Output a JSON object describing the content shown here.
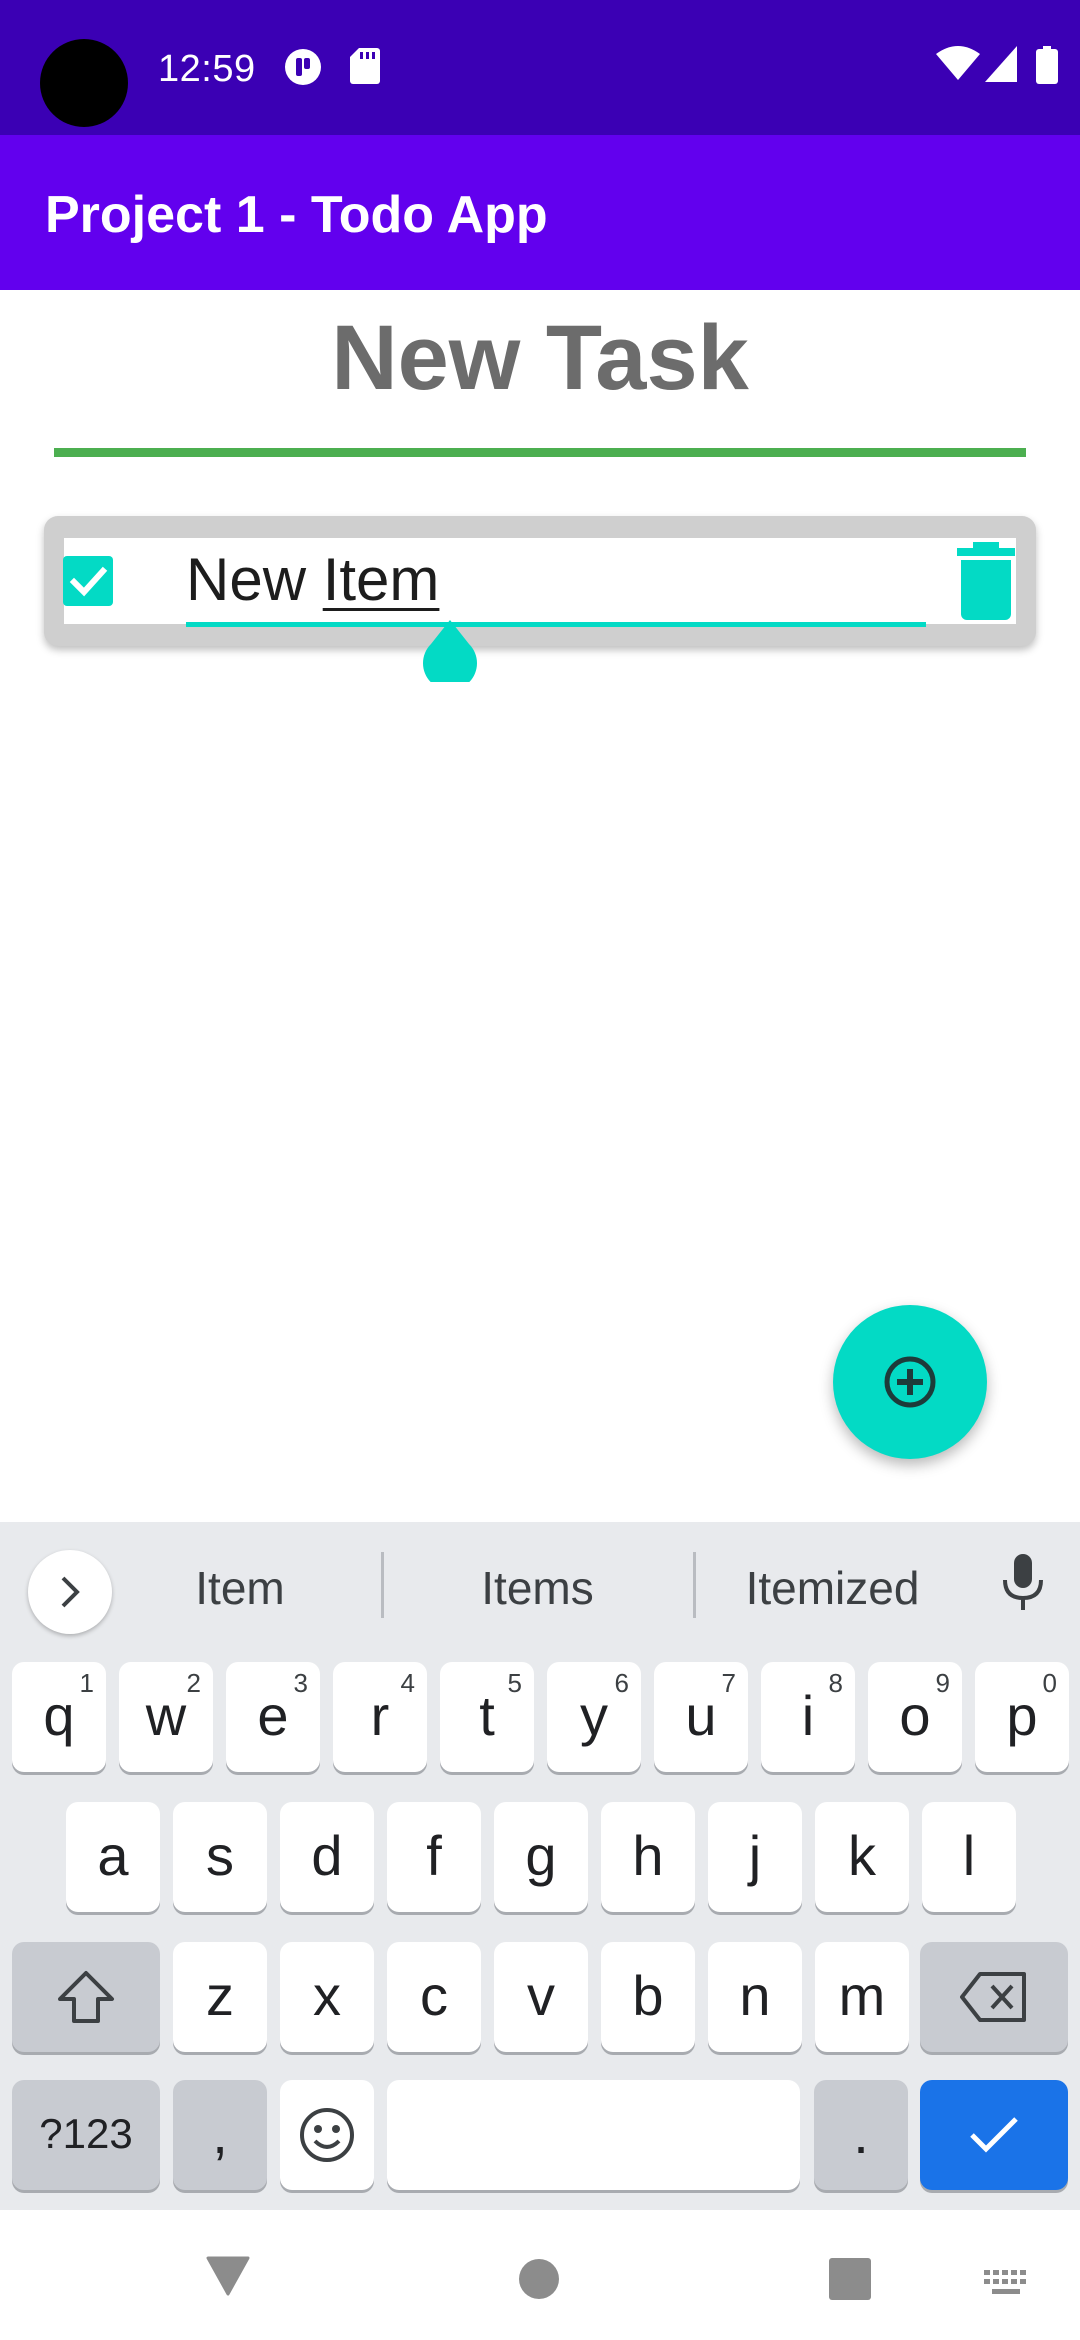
{
  "status_bar": {
    "time": "12:59",
    "icons": [
      "camera-cutout",
      "app-notification-icon",
      "sd-card-icon",
      "wifi-icon",
      "cell-signal-icon",
      "battery-icon"
    ]
  },
  "app_bar": {
    "title": "Project 1 - Todo App"
  },
  "main": {
    "heading": "New Task",
    "task": {
      "checked": true,
      "text_plain": "New ",
      "text_underlined": "Item",
      "value": "New Item",
      "icons": [
        "checkbox-icon",
        "trash-icon",
        "cursor-handle"
      ]
    },
    "fab_icon": "add-circle-icon"
  },
  "keyboard": {
    "suggestions": [
      "Item",
      "Items",
      "Itemized"
    ],
    "row1": [
      {
        "k": "q",
        "h": "1"
      },
      {
        "k": "w",
        "h": "2"
      },
      {
        "k": "e",
        "h": "3"
      },
      {
        "k": "r",
        "h": "4"
      },
      {
        "k": "t",
        "h": "5"
      },
      {
        "k": "y",
        "h": "6"
      },
      {
        "k": "u",
        "h": "7"
      },
      {
        "k": "i",
        "h": "8"
      },
      {
        "k": "o",
        "h": "9"
      },
      {
        "k": "p",
        "h": "0"
      }
    ],
    "row2": [
      "a",
      "s",
      "d",
      "f",
      "g",
      "h",
      "j",
      "k",
      "l"
    ],
    "row3": [
      "z",
      "x",
      "c",
      "v",
      "b",
      "n",
      "m"
    ],
    "symbols_label": "?123",
    "comma": ",",
    "period": ".",
    "icons": [
      "expand-suggestions-icon",
      "microphone-icon",
      "shift-icon",
      "backspace-icon",
      "emoji-icon",
      "check-icon"
    ]
  },
  "nav_bar": {
    "icons": [
      "back-icon",
      "home-icon",
      "recents-icon",
      "keyboard-switch-icon"
    ]
  },
  "colors": {
    "status_bar": "#3b00b4",
    "app_bar": "#6200ee",
    "accent": "#03dac5",
    "divider": "#4caf50",
    "enter_key": "#1a73e8"
  }
}
